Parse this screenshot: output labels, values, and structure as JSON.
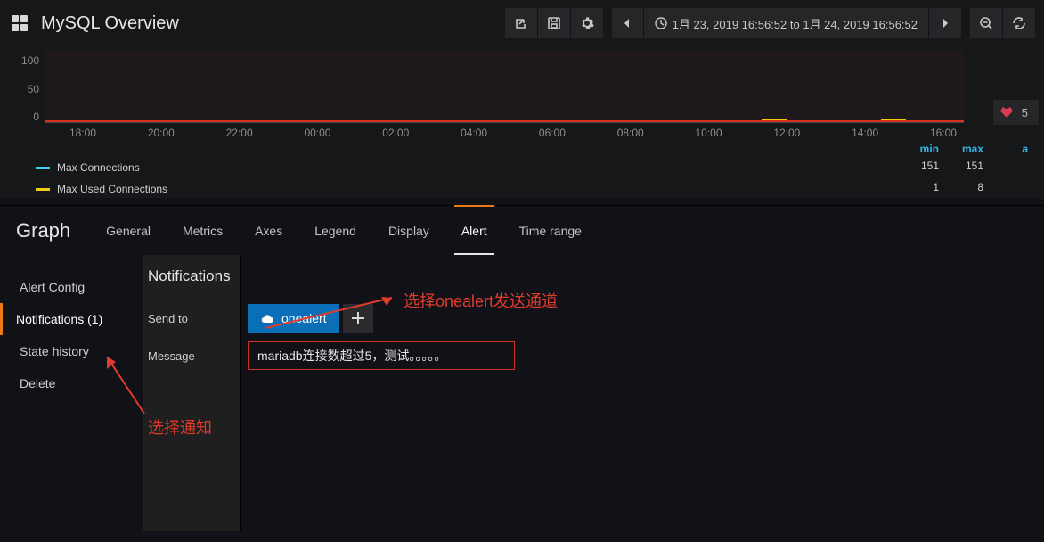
{
  "header": {
    "title": "MySQL Overview",
    "time_range": "1月 23, 2019 16:56:52 to 1月 24, 2019 16:56:52"
  },
  "chart_data": {
    "type": "line",
    "x_ticks": [
      "18:00",
      "20:00",
      "22:00",
      "00:00",
      "02:00",
      "04:00",
      "06:00",
      "08:00",
      "10:00",
      "12:00",
      "14:00",
      "16:00"
    ],
    "y_ticks": [
      "100",
      "50",
      "0"
    ],
    "ylim": [
      0,
      120
    ],
    "series": [
      {
        "name": "Max Connections",
        "color": "#3ecfef",
        "min": 151,
        "max": 151
      },
      {
        "name": "Max Used Connections",
        "color": "#f2cc0c",
        "min": 1,
        "max": 8
      }
    ],
    "legend_headers": {
      "min": "min",
      "max": "max",
      "avg": "a"
    }
  },
  "alert_badge": {
    "count": "5"
  },
  "editor": {
    "title": "Graph",
    "tabs": [
      "General",
      "Metrics",
      "Axes",
      "Legend",
      "Display",
      "Alert",
      "Time range"
    ],
    "active_tab": "Alert"
  },
  "alert_side": {
    "items": [
      {
        "label": "Alert Config"
      },
      {
        "label": "Notifications (1)",
        "active": true
      },
      {
        "label": "State history"
      },
      {
        "label": "Delete"
      }
    ]
  },
  "notif": {
    "section_title": "Notifications",
    "send_to_label": "Send to",
    "channel": "onealert",
    "message_label": "Message",
    "message_value": "mariadb连接数超过5，测试。。。。。"
  },
  "annotations": {
    "top": "选择onealert发送通道",
    "bottom": "选择通知"
  }
}
